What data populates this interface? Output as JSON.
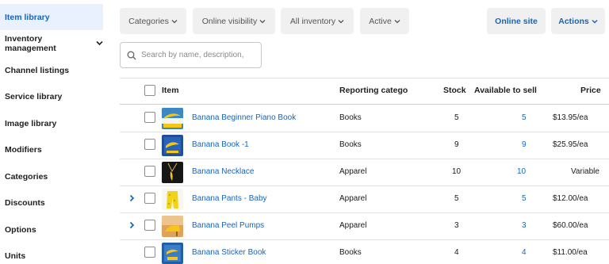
{
  "sidebar": {
    "items": [
      {
        "label": "Item library",
        "active": true
      },
      {
        "label": "Inventory management",
        "active": false,
        "has_chevron": true
      },
      {
        "label": "Channel listings",
        "active": false
      },
      {
        "label": "Service library",
        "active": false
      },
      {
        "label": "Image library",
        "active": false
      },
      {
        "label": "Modifiers",
        "active": false
      },
      {
        "label": "Categories",
        "active": false
      },
      {
        "label": "Discounts",
        "active": false
      },
      {
        "label": "Options",
        "active": false
      },
      {
        "label": "Units",
        "active": false
      }
    ]
  },
  "toolbar": {
    "categories_label": "Categories",
    "online_visibility_label": "Online visibility",
    "all_inventory_label": "All inventory",
    "active_label": "Active",
    "online_site_label": "Online site",
    "actions_label": "Actions"
  },
  "search": {
    "placeholder": "Search by name, description,"
  },
  "table": {
    "headers": {
      "item": "Item",
      "reporting_category": "Reporting catego",
      "stock": "Stock",
      "available": "Available to sell",
      "price": "Price"
    },
    "rows": [
      {
        "name": "Banana Beginner Piano Book",
        "category": "Books",
        "stock": "5",
        "available": "5",
        "price": "$13.95/ea",
        "expandable": false,
        "thumb": "piano-book"
      },
      {
        "name": "Banana Book -1",
        "category": "Books",
        "stock": "9",
        "available": "9",
        "price": "$25.95/ea",
        "expandable": false,
        "thumb": "book"
      },
      {
        "name": "Banana Necklace",
        "category": "Apparel",
        "stock": "10",
        "available": "10",
        "price": "Variable",
        "expandable": false,
        "thumb": "necklace"
      },
      {
        "name": "Banana Pants - Baby",
        "category": "Apparel",
        "stock": "5",
        "available": "5",
        "price": "$12.00/ea",
        "expandable": true,
        "thumb": "pants"
      },
      {
        "name": "Banana Peel Pumps",
        "category": "Apparel",
        "stock": "3",
        "available": "3",
        "price": "$60.00/ea",
        "expandable": true,
        "thumb": "pumps"
      },
      {
        "name": "Banana Sticker Book",
        "category": "Books",
        "stock": "4",
        "available": "4",
        "price": "$11.00/ea",
        "expandable": false,
        "thumb": "sticker-book"
      }
    ]
  },
  "colors": {
    "accent": "#1565c0",
    "active_nav_bg": "#e8f1fd",
    "chip_bg": "#f0f0f0"
  }
}
